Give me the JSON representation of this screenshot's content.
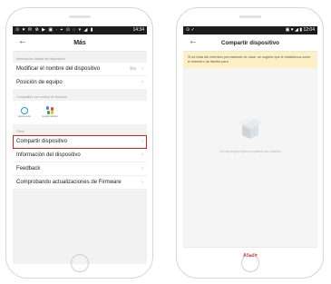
{
  "left": {
    "status": {
      "icons": "⊙ ♥ ✉ ⊗ ▶ ▣ · ⌖ ⊙ ◌ ▾ ◢ ▮",
      "time": "14:34"
    },
    "header": {
      "title": "Más"
    },
    "basic_info": {
      "label": "Información básica del dispositivo",
      "rows": [
        {
          "label": "Modificar el nombre del dispositivo",
          "value": "lba"
        },
        {
          "label": "Posición de equipo",
          "value": ""
        }
      ]
    },
    "voice": {
      "label": "Compatible con control de terceros",
      "items": [
        {
          "caption": "amazon echo",
          "icon": "alexa-icon"
        },
        {
          "caption": "Google Assistant",
          "icon": "google-assistant-icon"
        }
      ]
    },
    "others": {
      "label": "Otros",
      "rows": [
        {
          "label": "Compartir dispositivo",
          "highlight": true
        },
        {
          "label": "Información del dispositivo"
        },
        {
          "label": "Feedback"
        },
        {
          "label": "Comprobando actualizaciones de Firmware"
        }
      ]
    }
  },
  "right": {
    "status": {
      "icons": "⊙ ✓",
      "right_icons": "▣ ♥ ◢ ▮",
      "time": "12:04"
    },
    "header": {
      "title": "Compartir dispositivo"
    },
    "notice": "Si se trata del miembro permanente de casa, se sugiere que le establezca como el miembro de familia para",
    "empty_text": "No hay ningún objeto compartido aún añadido",
    "add_button": "Añadir"
  },
  "colors": {
    "accent": "#e02020",
    "notice_bg": "#fdf0c4"
  }
}
